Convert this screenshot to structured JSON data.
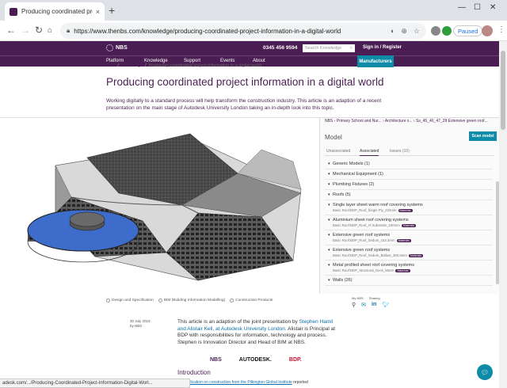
{
  "browser": {
    "tab_title": "Producing coordinated project in",
    "tab_close": "×",
    "new_tab": "+",
    "url": "https://www.thenbs.com/knowledge/producing-coordinated-project-information-in-a-digital-world",
    "paused_label": "Paused",
    "status_url": "adesk.com/.../Producing-Coordinated-Project-Information-Digital-Worl..."
  },
  "header": {
    "logo_text": "NBS",
    "phone": "0345 456 9594",
    "search_placeholder": "Search Knowledge",
    "signin_label": "Sign in / Register"
  },
  "nav": {
    "items": [
      "Platform",
      "Knowledge",
      "Support",
      "Events",
      "About"
    ],
    "manufacturers_label": "Manufacturers"
  },
  "breadcrumb": [
    "NBS",
    "Knowledge",
    "Producing coordinated project information in a digital world"
  ],
  "article": {
    "title": "Producing coordinated project information in a digital world",
    "intro": "Working digitally to a standard process will help transform the construction industry. This article is an adaption of a recent presentation on the main stage of Autodesk University London taking an in-depth look into this topic.",
    "tags": [
      "Design and Specification",
      "BIM (Building Information Modelling)",
      "Construction Products"
    ],
    "my_nbs_label": "My NBS",
    "sharing_label": "Sharing",
    "date": "30 July 2019",
    "by": "by NBS",
    "body_pre": "This article is an adaption of the joint presentation by ",
    "body_link": "Stephen Hamil and Alistair Kell, at Autodesk University London",
    "body_post": ". Alistair is Principal at BDP with responsibilities for information, technology and process. Stephen is Innovation Director and Head of BIM at NBS.",
    "logos": [
      "NBS",
      "AUTODESK.",
      "BDP."
    ],
    "intro_heading": "Introduction",
    "body2_link": "publication on construction from the Pilkington Global Institute",
    "body2_post": " reported"
  },
  "viewer": {
    "breadcrumb": "NBS › Primary School and Nur... › Architecture s... › Ss_45_40_47_28 Extensive green roof...",
    "title": "Model",
    "scan_label": "Scan model",
    "tabs": [
      "Unassociated",
      "Associated",
      "Issues (10)"
    ],
    "rows": [
      {
        "label": "Generic Models (1)"
      },
      {
        "label": "Mechanical Equipment (1)"
      },
      {
        "label": "Plumbing Fixtures (2)"
      },
      {
        "label": "Roofs (5)"
      },
      {
        "label": "Single layer sheet warm roof covering systems",
        "sub": "Basic Roof:BDP_Roof_Single Ply_220mm",
        "tag": "Materials"
      },
      {
        "label": "Aluminium sheet roof covering systems",
        "sub": "Basic Roof:BDP_Roof_Al Substrate_240mm",
        "tag": "Materials"
      },
      {
        "label": "Extensive green roof systems",
        "sub": "Basic Roof:BDP_Roof_Sedum_152.3mm",
        "tag": "Materials"
      },
      {
        "label": "Extensive green roof systems",
        "sub": "Basic Roof:BDP_Roof_Sedum_Ballast_350.5mm",
        "tag": "Materials"
      },
      {
        "label": "Metal profiled sheet roof covering systems",
        "sub": "Basic Roof:BDP_Structural_Deck_Warm",
        "tag": "Materials"
      },
      {
        "label": "Walls (26)"
      }
    ]
  },
  "colors": {
    "brand": "#4a1e52",
    "accent": "#0e8ba6",
    "roof_blue": "#3d6ccb"
  }
}
